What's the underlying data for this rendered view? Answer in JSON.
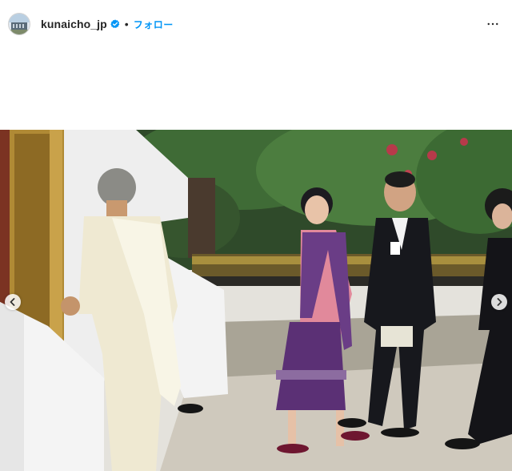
{
  "post_header": {
    "username": "kunaicho_jp",
    "verified": true,
    "separator": "•",
    "follow_label": "フォロー",
    "avatar_icon": "building-avatar-icon",
    "more_icon": "more-horizontal-icon"
  },
  "carousel": {
    "prev_icon": "chevron-left-icon",
    "next_icon": "chevron-right-icon"
  },
  "colors": {
    "follow_blue": "#0095f6",
    "verified_blue": "#0095f6",
    "text": "#262626"
  }
}
